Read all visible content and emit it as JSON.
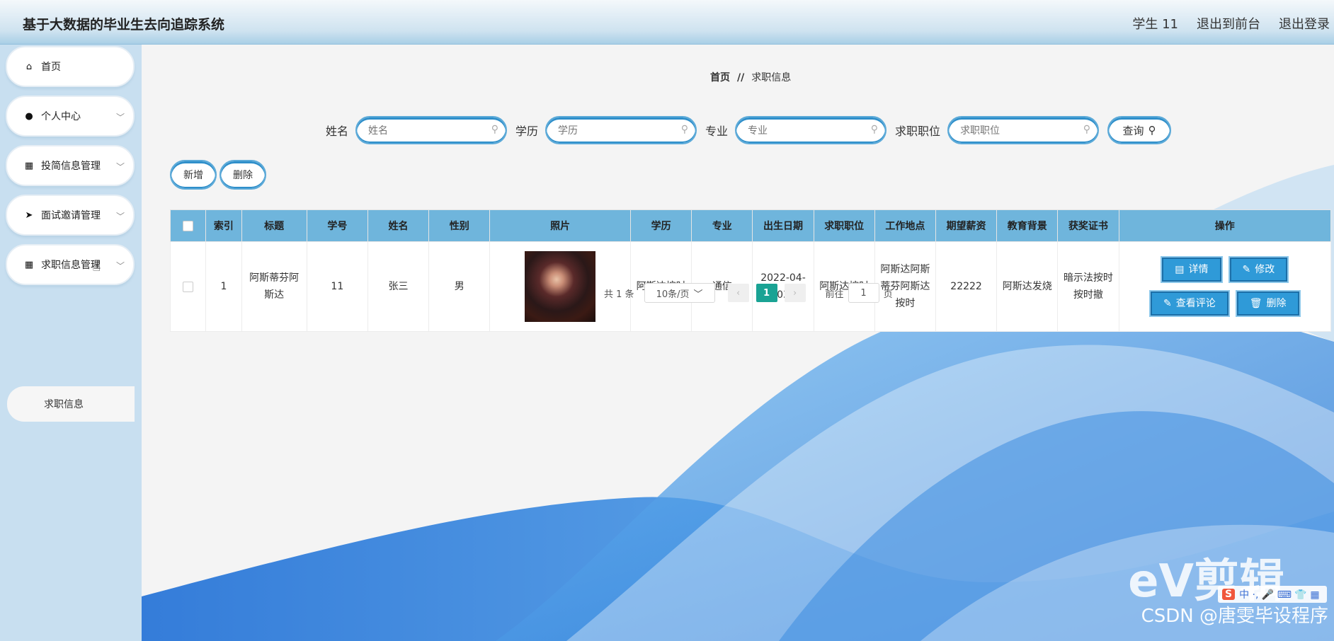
{
  "app": {
    "title": "基于大数据的毕业生去向追踪系统"
  },
  "topbar": {
    "user": "学生 11",
    "front": "退出到前台",
    "logout": "退出登录"
  },
  "sidebar": {
    "items": [
      {
        "label": "首页",
        "icon": "home-icon"
      },
      {
        "label": "个人中心",
        "icon": "user-icon"
      },
      {
        "label": "投简信息管理",
        "icon": "grid-icon"
      },
      {
        "label": "面试邀请管理",
        "icon": "send-icon"
      },
      {
        "label": "求职信息管理",
        "icon": "grid-icon"
      }
    ],
    "sub": "求职信息"
  },
  "breadcrumb": {
    "home": "首页",
    "sep": "//",
    "current": "求职信息"
  },
  "search": {
    "name_label": "姓名",
    "name_ph": "姓名",
    "edu_label": "学历",
    "edu_ph": "学历",
    "major_label": "专业",
    "major_ph": "专业",
    "pos_label": "求职职位",
    "pos_ph": "求职职位",
    "query": "查询"
  },
  "actions": {
    "add": "新增",
    "delete": "删除"
  },
  "table": {
    "headers": [
      "索引",
      "标题",
      "学号",
      "姓名",
      "性别",
      "照片",
      "学历",
      "专业",
      "出生日期",
      "求职职位",
      "工作地点",
      "期望薪资",
      "教育背景",
      "获奖证书",
      "操作"
    ],
    "rows": [
      {
        "index": "1",
        "title": "阿斯蒂芬阿斯达",
        "xuehao": "11",
        "name": "张三",
        "gender": "男",
        "edu": "阿斯达按时",
        "major": "通信",
        "birth": "2022-04-03",
        "position": "阿斯达按时",
        "location": "阿斯达阿斯蒂芬阿斯达按时",
        "salary": "22222",
        "background": "阿斯达发烧",
        "award": "暗示法按时按时撤"
      }
    ],
    "ops": {
      "detail": "详情",
      "edit": "修改",
      "comment": "查看评论",
      "del": "删除"
    }
  },
  "pager": {
    "total": "共 1 条",
    "size": "10条/页",
    "current": "1",
    "goto_pre": "前往",
    "goto_val": "1",
    "goto_post": "页"
  },
  "watermark": {
    "logo": "eV剪辑",
    "csdn": "CSDN @唐雯毕设程序"
  },
  "colors": {
    "header": "#6fb5dc",
    "button": "#2f9ad8",
    "page_active": "#1aa394",
    "sidebar": "#c8dff0"
  }
}
